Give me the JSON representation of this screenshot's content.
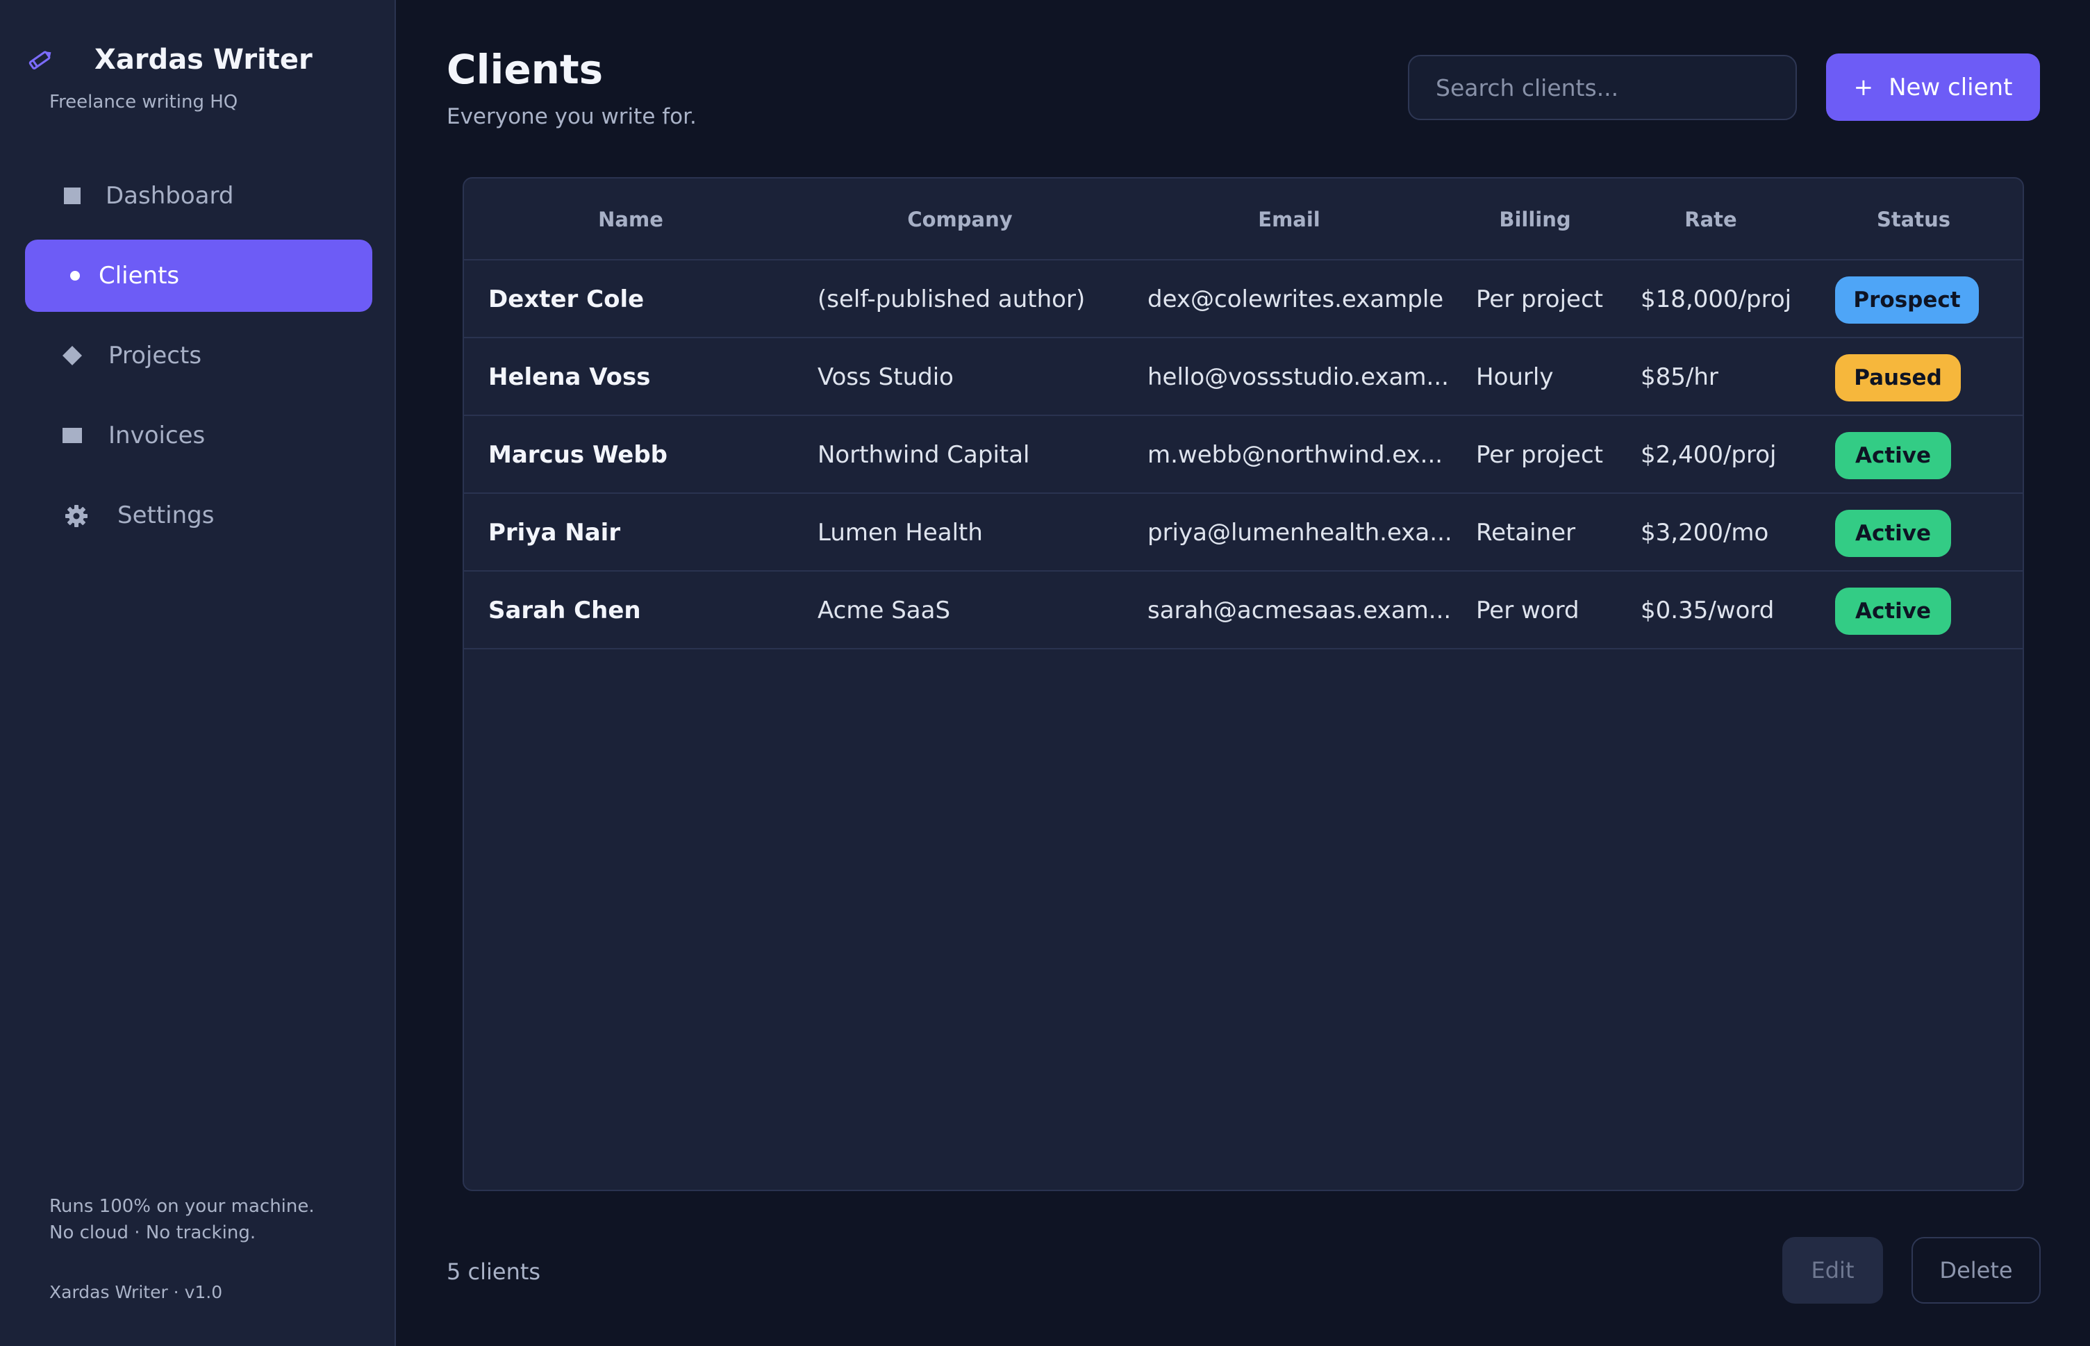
{
  "app": {
    "name": "Xardas Writer",
    "tagline": "Freelance writing HQ",
    "footer_line1": "Runs 100% on your machine.",
    "footer_line2": "No cloud · No tracking.",
    "version_label": "Xardas Writer · v1.0",
    "accent_color": "#6d5cf6"
  },
  "sidebar": {
    "items": [
      {
        "label": "Dashboard",
        "icon": "square-icon",
        "active": false
      },
      {
        "label": "Clients",
        "icon": "dot-icon",
        "active": true
      },
      {
        "label": "Projects",
        "icon": "diamond-icon",
        "active": false
      },
      {
        "label": "Invoices",
        "icon": "rectangle-icon",
        "active": false
      },
      {
        "label": "Settings",
        "icon": "gear-icon",
        "active": false
      }
    ]
  },
  "header": {
    "title": "Clients",
    "subtitle": "Everyone you write for.",
    "search_placeholder": "Search clients...",
    "search_value": "",
    "new_button_label": "New client",
    "new_button_icon": "+"
  },
  "table": {
    "columns": [
      "Name",
      "Company",
      "Email",
      "Billing",
      "Rate",
      "Status"
    ],
    "rows": [
      {
        "name": "Dexter Cole",
        "company": "(self-published author)",
        "email": "dex@colewrites.example",
        "billing": "Per project",
        "rate": "$18,000/proj",
        "status": "Prospect"
      },
      {
        "name": "Helena Voss",
        "company": "Voss Studio",
        "email": "hello@vossstudio.exam...",
        "billing": "Hourly",
        "rate": "$85/hr",
        "status": "Paused"
      },
      {
        "name": "Marcus Webb",
        "company": "Northwind Capital",
        "email": "m.webb@northwind.ex...",
        "billing": "Per project",
        "rate": "$2,400/proj",
        "status": "Active"
      },
      {
        "name": "Priya Nair",
        "company": "Lumen Health",
        "email": "priya@lumenhealth.exa...",
        "billing": "Retainer",
        "rate": "$3,200/mo",
        "status": "Active"
      },
      {
        "name": "Sarah Chen",
        "company": "Acme SaaS",
        "email": "sarah@acmesaas.exam...",
        "billing": "Per word",
        "rate": "$0.35/word",
        "status": "Active"
      }
    ],
    "status_colors": {
      "Prospect": "#4ea5f7",
      "Paused": "#f6b73c",
      "Active": "#33cc85"
    }
  },
  "footer": {
    "count_label": "5 clients",
    "edit_label": "Edit",
    "delete_label": "Delete"
  }
}
